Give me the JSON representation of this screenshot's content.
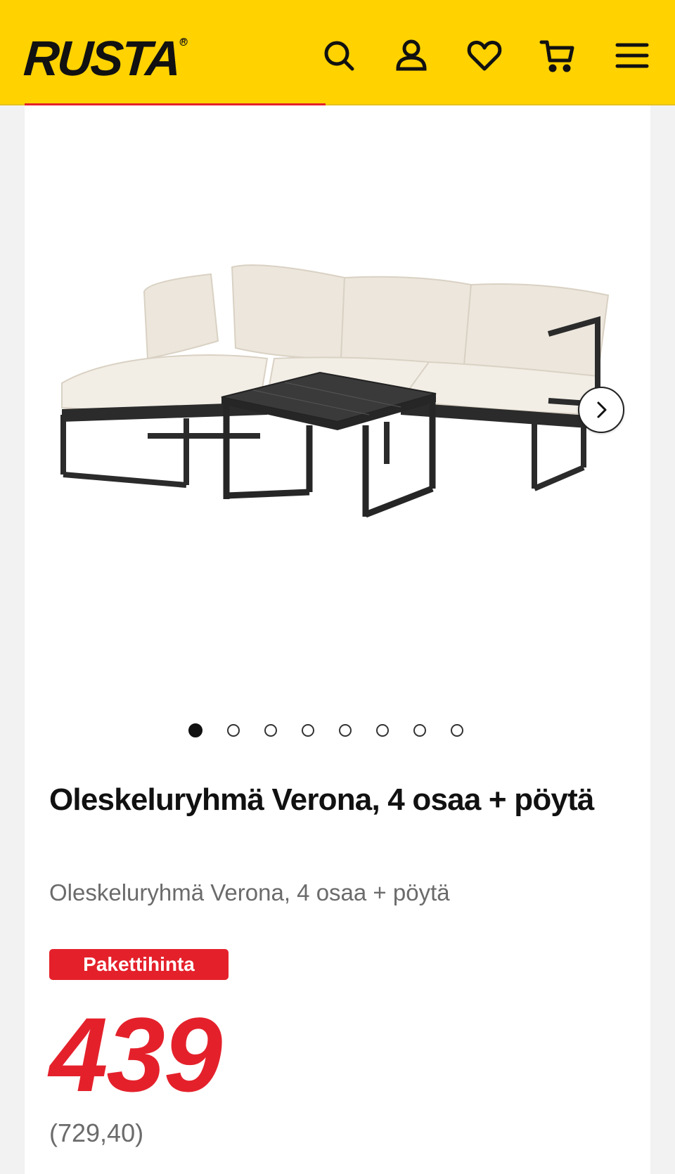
{
  "header": {
    "logo": "RUSTA",
    "icons": [
      "search-icon",
      "account-icon",
      "heart-icon",
      "cart-icon",
      "menu-icon"
    ],
    "background": "#ffd200"
  },
  "gallery": {
    "image_alt": "Oleskeluryhmä Verona, 4 osaa + pöytä",
    "slide_count": 8,
    "active_slide": 1
  },
  "product": {
    "title": "Oleskeluryhmä Verona, 4 osaa + pöytä",
    "subtitle": "Oleskeluryhmä Verona, 4 osaa + pöytä",
    "badge": "Pakettihinta",
    "price": "439",
    "previous_price": "(729,40)"
  },
  "colors": {
    "accent_red": "#e4212b",
    "brand_yellow": "#ffd200"
  }
}
